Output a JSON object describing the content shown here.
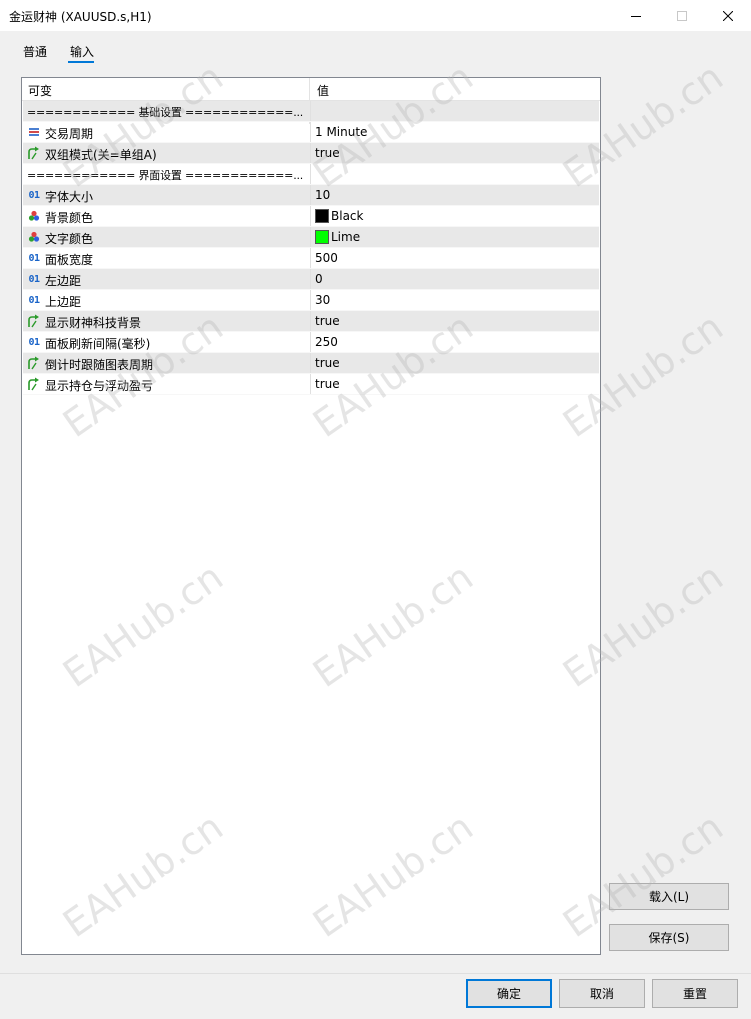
{
  "window": {
    "title": "金运财神 (XAUUSD.s,H1)"
  },
  "tabs": [
    {
      "label": "普通"
    },
    {
      "label": "输入"
    }
  ],
  "grid": {
    "columns": {
      "name": "可变",
      "value": "值"
    },
    "rows": [
      {
        "type": "separator",
        "name": "============ 基础设置 ============...",
        "value": ""
      },
      {
        "type": "enum",
        "icon": "list-icon",
        "name": "交易周期",
        "value": "1 Minute"
      },
      {
        "type": "bool",
        "icon": "arrow-icon",
        "name": "双组模式(关=单组A)",
        "value": "true"
      },
      {
        "type": "separator",
        "name": "============ 界面设置 ============...",
        "value": ""
      },
      {
        "type": "int",
        "icon": "int-icon",
        "name": "字体大小",
        "value": "10"
      },
      {
        "type": "color",
        "icon": "color-icon",
        "name": "背景颜色",
        "value": "Black",
        "swatch": "#000000"
      },
      {
        "type": "color",
        "icon": "color-icon",
        "name": "文字颜色",
        "value": "Lime",
        "swatch": "#00ff00"
      },
      {
        "type": "int",
        "icon": "int-icon",
        "name": "面板宽度",
        "value": "500"
      },
      {
        "type": "int",
        "icon": "int-icon",
        "name": "左边距",
        "value": "0"
      },
      {
        "type": "int",
        "icon": "int-icon",
        "name": "上边距",
        "value": "30"
      },
      {
        "type": "bool",
        "icon": "arrow-icon",
        "name": "显示财神科技背景",
        "value": "true"
      },
      {
        "type": "int",
        "icon": "int-icon",
        "name": "面板刷新间隔(毫秒)",
        "value": "250"
      },
      {
        "type": "bool",
        "icon": "arrow-icon",
        "name": "倒计时跟随图表周期",
        "value": "true"
      },
      {
        "type": "bool",
        "icon": "arrow-icon",
        "name": "显示持仓与浮动盈亏",
        "value": "true"
      }
    ]
  },
  "side_buttons": {
    "load": "载入(L)",
    "save": "保存(S)"
  },
  "footer": {
    "ok": "确定",
    "cancel": "取消",
    "reset": "重置"
  },
  "int_icon_text": "01",
  "watermark": "EAHub.cn"
}
